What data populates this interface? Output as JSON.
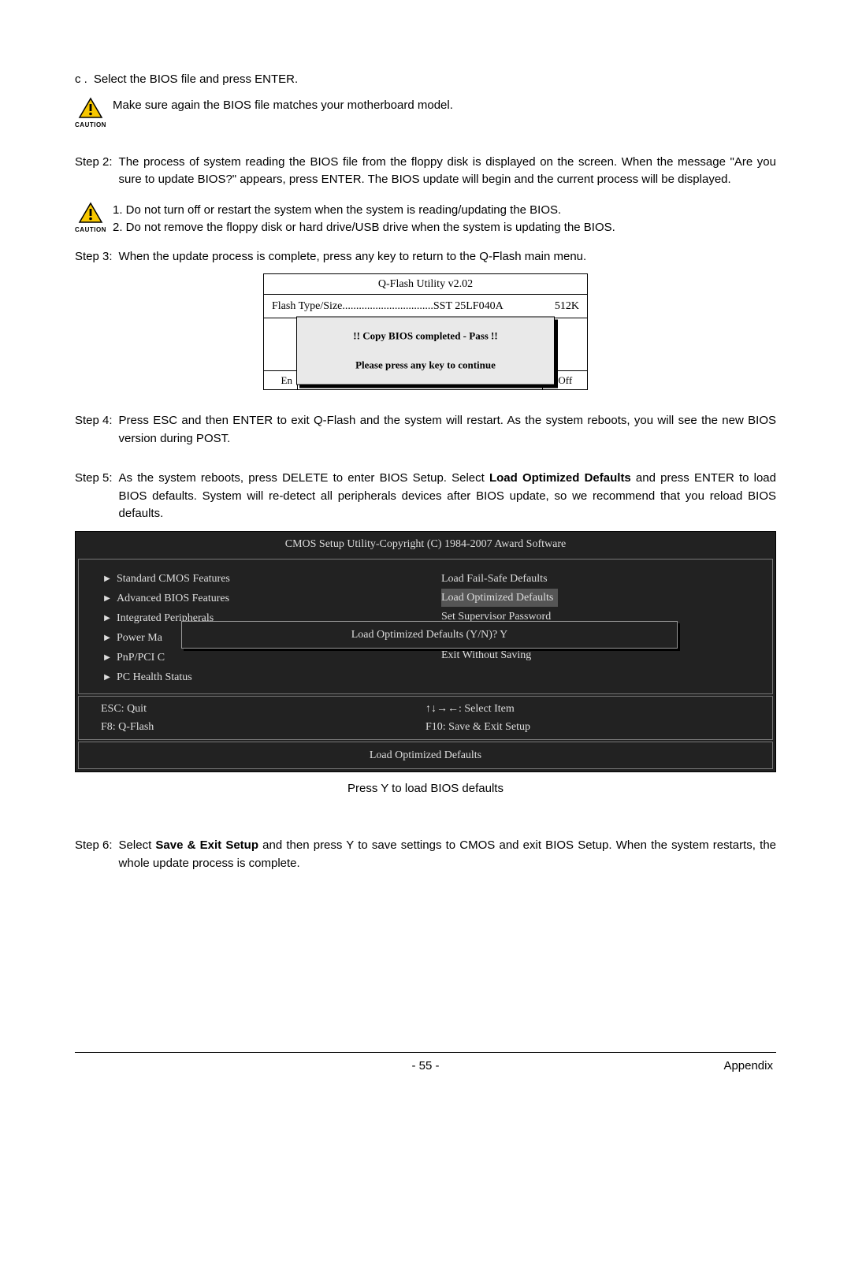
{
  "step_c": {
    "label": "c .",
    "text": "Select the BIOS file and press ENTER."
  },
  "caution1": {
    "label": "CAUTION",
    "text": "Make sure again the BIOS file matches your motherboard model."
  },
  "step2": {
    "label": "Step 2:",
    "text": "The process of system reading the BIOS file from the floppy disk is displayed on the screen. When the message \"Are you sure to update BIOS?\" appears, press ENTER. The BIOS update will begin and the current process will be displayed."
  },
  "caution2": {
    "label": "CAUTION",
    "line1": "1. Do not turn off or restart the system when the system is reading/updating the BIOS.",
    "line2": "2. Do not remove the floppy disk or hard drive/USB drive when the system is updating the BIOS."
  },
  "step3": {
    "label": "Step 3:",
    "text": "When the update process is complete, press any key to return to the Q-Flash main menu."
  },
  "qflash": {
    "title": "Q-Flash Utility v2.02",
    "info_left": "Flash Type/Size.................................SST 25LF040A",
    "info_right": "512K",
    "popup_line1": "!! Copy BIOS completed - Pass !!",
    "popup_line2": "Please press any key to continue",
    "footer_left_partial": "En",
    "footer_right_partial": "er Off"
  },
  "step4": {
    "label": "Step 4:",
    "text": "Press ESC and then ENTER to exit Q-Flash and the system will restart. As the system reboots, you will see the new BIOS version during POST."
  },
  "step5": {
    "label": "Step 5:",
    "text_pre": "As the system reboots, press DELETE to enter BIOS Setup. Select ",
    "text_bold": "Load Optimized Defaults",
    "text_post": " and press ENTER to load BIOS defaults. System will re-detect all peripherals devices after BIOS update, so we recommend that you reload BIOS defaults."
  },
  "bios": {
    "title": "CMOS Setup Utility-Copyright (C) 1984-2007 Award Software",
    "left_items": [
      "Standard CMOS Features",
      "Advanced BIOS Features",
      "Integrated Peripherals",
      "Power Ma",
      "PnP/PCI C",
      "PC Health Status"
    ],
    "right_items": [
      {
        "text": "Load Fail-Safe Defaults",
        "highlight": false
      },
      {
        "text": "Load Optimized Defaults",
        "highlight": true
      },
      {
        "text": "Set Supervisor Password",
        "highlight": false
      },
      {
        "text": "",
        "highlight": false
      },
      {
        "text": "Exit Without Saving",
        "highlight": false
      }
    ],
    "prompt": "Load Optimized Defaults (Y/N)? Y",
    "footer_left_1": "ESC: Quit",
    "footer_left_2": "F8: Q-Flash",
    "footer_right_1": "↑↓→←: Select Item",
    "footer_right_2": "F10: Save & Exit Setup",
    "footer_bottom": "Load Optimized Defaults"
  },
  "caption": "Press Y to load BIOS defaults",
  "step6": {
    "label": "Step 6:",
    "text_pre": "Select ",
    "text_bold": "Save & Exit Setup",
    "text_post": " and then press Y to save settings to CMOS and exit BIOS Setup. When the system restarts, the whole update process is complete."
  },
  "footer": {
    "page": "- 55 -",
    "section": "Appendix"
  }
}
